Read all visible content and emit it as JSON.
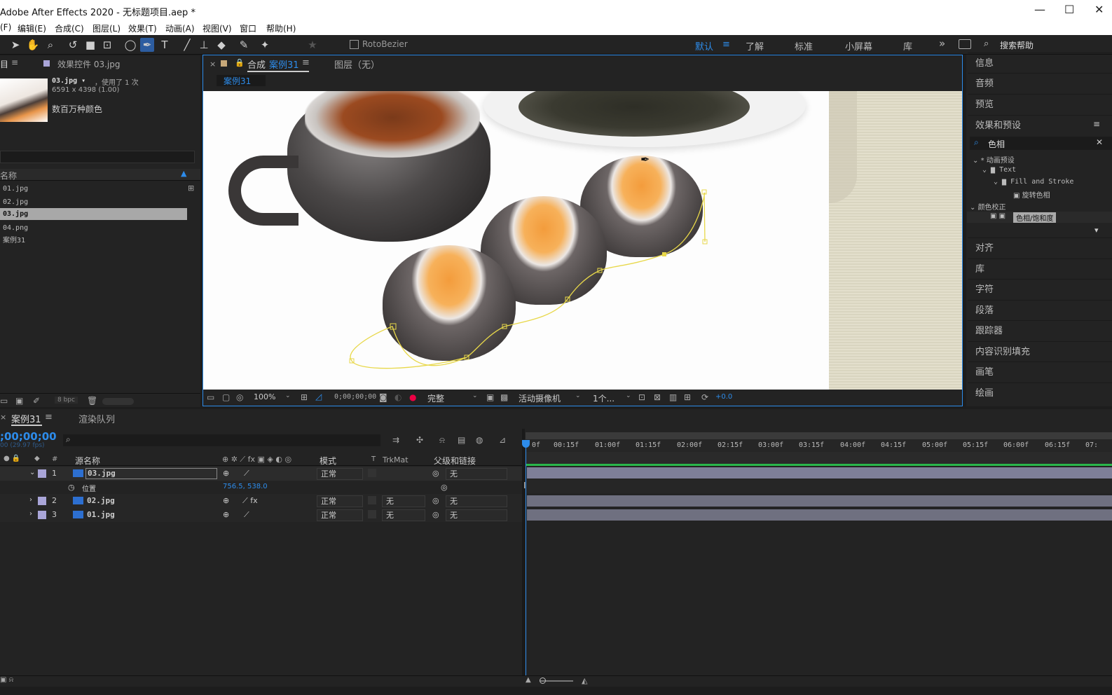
{
  "window": {
    "title": "Adobe After Effects 2020 - 无标题项目.aep *",
    "minimize": "—",
    "maximize": "☐",
    "close": "✕"
  },
  "menu": [
    "(F)",
    "编辑(E)",
    "合成(C)",
    "图层(L)",
    "效果(T)",
    "动画(A)",
    "视图(V)",
    "窗口",
    "帮助(H)"
  ],
  "toolbar": {
    "rotobezier": "RotoBezier",
    "workspaces": [
      "默认",
      "了解",
      "标准",
      "小屏幕",
      "库"
    ],
    "more": "»",
    "search_placeholder": "搜索帮助"
  },
  "project": {
    "tab_project": "目",
    "tab_effects": "效果控件 03.jpg",
    "selected_name": "03.jpg ▾",
    "used_count": "，使用了 1 次",
    "dimensions": "6591 x 4398 (1.00)",
    "colors": "数百万种颜色",
    "col_name": "名称",
    "items": [
      "01.jpg",
      "02.jpg",
      "03.jpg",
      "04.png",
      "案例31"
    ],
    "bpc": "8 bpc"
  },
  "composition": {
    "tab_comp_prefix": "合成",
    "tab_comp_name": "案例31",
    "tab_layer": "图层（无）",
    "subtab": "案例31",
    "zoom": "100%",
    "timecode": "0;00;00;00",
    "resolution": "完整",
    "camera": "活动摄像机",
    "views": "1个...",
    "exposure": "+0.0"
  },
  "right_panel": {
    "top_items": [
      "信息",
      "音频",
      "预览",
      "效果和预设"
    ],
    "search_value": "色相",
    "tree": [
      "* 动画预设",
      "Text",
      "Fill and Stroke",
      "旋转色相",
      "颜色校正",
      "色相/饱和度"
    ],
    "bottom_items": [
      "对齐",
      "库",
      "字符",
      "段落",
      "跟踪器",
      "内容识别填充",
      "画笔",
      "绘画"
    ]
  },
  "timeline": {
    "tab": "案例31",
    "tab_render": "渲染队列",
    "timecode": ";00;00;00",
    "fps": "00 (29.97 fps)",
    "headers": {
      "num": "#",
      "source": "源名称",
      "mode": "模式",
      "t": "T",
      "trkmat": "TrkMat",
      "parent": "父级和链接"
    },
    "layers": [
      {
        "num": "1",
        "name": "03.jpg",
        "mode": "正常",
        "trkmat": "",
        "parent": "无"
      },
      {
        "num": "2",
        "name": "02.jpg",
        "mode": "正常",
        "trkmat": "无",
        "parent": "无"
      },
      {
        "num": "3",
        "name": "01.jpg",
        "mode": "正常",
        "trkmat": "无",
        "parent": "无"
      }
    ],
    "position_label": "位置",
    "position_value": "756.5, 538.0",
    "ruler": [
      "0f",
      "00:15f",
      "01:00f",
      "01:15f",
      "02:00f",
      "02:15f",
      "03:00f",
      "03:15f",
      "04:00f",
      "04:15f",
      "05:00f",
      "05:15f",
      "06:00f",
      "06:15f",
      "07:"
    ]
  },
  "colors": {
    "accent": "#2d8ceb",
    "path": "#e8d84a",
    "label_lavender": "#a9a5d8",
    "bar": "#7e7f98"
  }
}
